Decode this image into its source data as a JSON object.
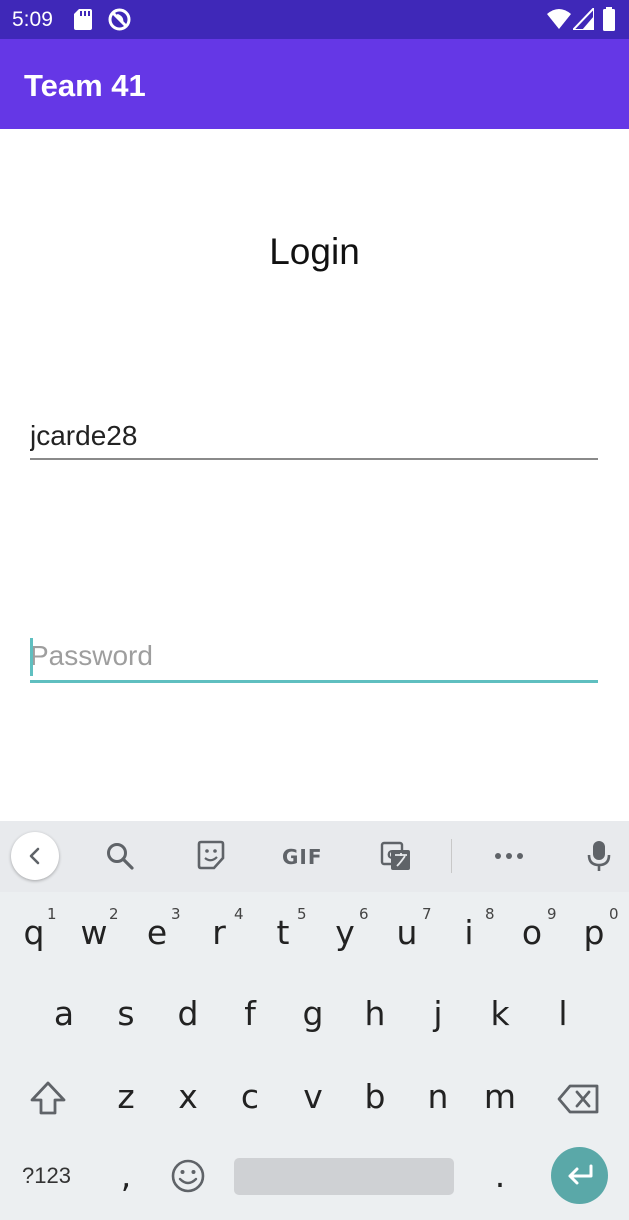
{
  "status_bar": {
    "time": "5:09",
    "icons": [
      "sd-card-icon",
      "do-not-disturb-icon",
      "wifi-icon",
      "signal-icon",
      "battery-icon"
    ]
  },
  "app_bar": {
    "title": "Team 41",
    "color": "#6537e6"
  },
  "content": {
    "heading": "Login",
    "username_value": "jcarde28",
    "password_placeholder": "Password",
    "accent_color": "#5fbfc0"
  },
  "keyboard": {
    "toolbar": [
      "back-icon",
      "search-icon",
      "sticker-icon",
      "gif-icon",
      "translate-icon",
      "more-icon",
      "mic-icon"
    ],
    "gif_label": "GIF",
    "row1": [
      {
        "key": "q",
        "hint": "1"
      },
      {
        "key": "w",
        "hint": "2"
      },
      {
        "key": "e",
        "hint": "3"
      },
      {
        "key": "r",
        "hint": "4"
      },
      {
        "key": "t",
        "hint": "5"
      },
      {
        "key": "y",
        "hint": "6"
      },
      {
        "key": "u",
        "hint": "7"
      },
      {
        "key": "i",
        "hint": "8"
      },
      {
        "key": "o",
        "hint": "9"
      },
      {
        "key": "p",
        "hint": "0"
      }
    ],
    "row2": [
      "a",
      "s",
      "d",
      "f",
      "g",
      "h",
      "j",
      "k",
      "l"
    ],
    "row3": [
      "z",
      "x",
      "c",
      "v",
      "b",
      "n",
      "m"
    ],
    "bottom": {
      "symbols": "?123",
      "comma": ",",
      "period": "."
    }
  }
}
